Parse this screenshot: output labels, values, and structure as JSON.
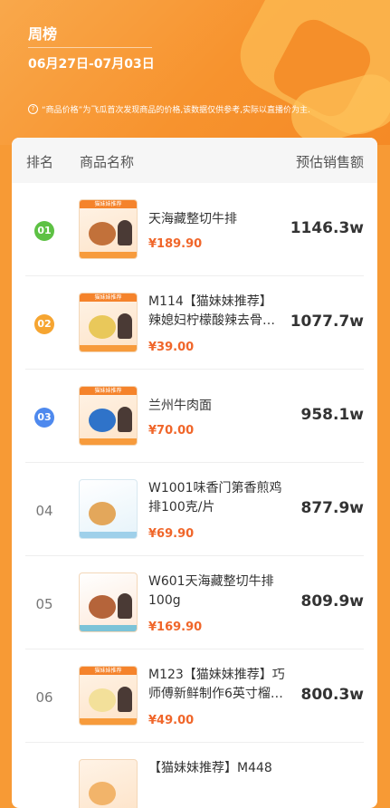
{
  "header": {
    "title": "周榜",
    "date_range": "06月27日-07月03日",
    "note": "“商品价格”为飞瓜首次发现商品的价格,该数据仅供参考,实际以直播价为主."
  },
  "table": {
    "columns": [
      "排名",
      "商品名称",
      "预估销售额"
    ],
    "rows": [
      {
        "rank": "01",
        "name_line1": "天海藏整切牛排",
        "name_line2": "",
        "price": "¥189.90",
        "sales": "1146.3w",
        "thumb_tag": "猫妹妹推荐",
        "food_color": "#c2713a"
      },
      {
        "rank": "02",
        "name_line1": "M114【猫妹妹推荐】",
        "name_line2": "辣媳妇柠檬酸辣去骨…",
        "price": "¥39.00",
        "sales": "1077.7w",
        "thumb_tag": "猫妹妹推荐",
        "food_color": "#e9c85a"
      },
      {
        "rank": "03",
        "name_line1": "兰州牛肉面",
        "name_line2": "",
        "price": "¥70.00",
        "sales": "958.1w",
        "thumb_tag": "猫妹妹推荐",
        "food_color": "#2f73c9"
      },
      {
        "rank": "04",
        "name_line1": "W1001味香门第香煎鸡",
        "name_line2": "排100克/片",
        "price": "¥69.90",
        "sales": "877.9w",
        "thumb_tag": "",
        "food_color": "#e3a75b"
      },
      {
        "rank": "05",
        "name_line1": "W601天海藏整切牛排",
        "name_line2": "100g",
        "price": "¥169.90",
        "sales": "809.9w",
        "thumb_tag": "",
        "food_color": "#b5643a"
      },
      {
        "rank": "06",
        "name_line1": "M123【猫妹妹推荐】巧",
        "name_line2": "师傅新鲜制作6英寸榴…",
        "price": "¥49.00",
        "sales": "800.3w",
        "thumb_tag": "猫妹妹推荐",
        "food_color": "#f3e09a"
      },
      {
        "rank": "",
        "name_line1": "【猫妹妹推荐】M448",
        "name_line2": "",
        "price": "",
        "sales": "",
        "thumb_tag": "",
        "food_color": "#f2b46a"
      }
    ]
  }
}
